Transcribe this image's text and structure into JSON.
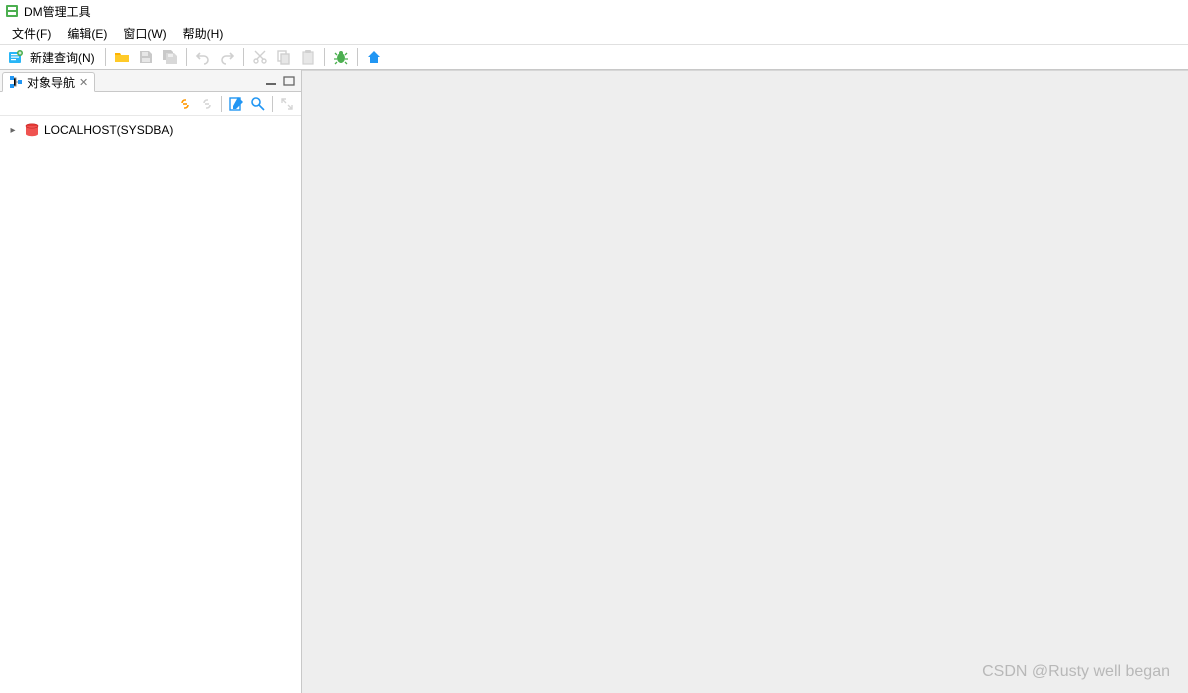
{
  "app": {
    "title": "DM管理工具"
  },
  "menu": {
    "file": "文件(F)",
    "edit": "编辑(E)",
    "window": "窗口(W)",
    "help": "帮助(H)"
  },
  "toolbar": {
    "new_query_label": "新建查询(N)"
  },
  "sidebar": {
    "tab_title": "对象导航",
    "tree": {
      "root": {
        "label": "LOCALHOST(SYSDBA)",
        "expanded": false
      }
    }
  },
  "watermark": "CSDN @Rusty well began"
}
